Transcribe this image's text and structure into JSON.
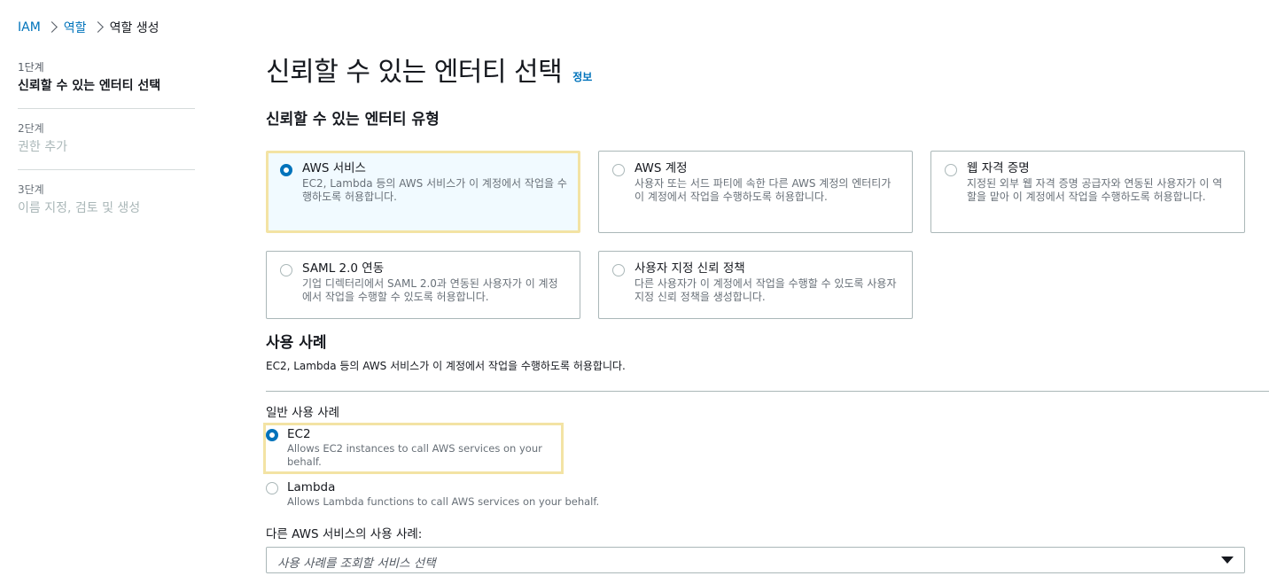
{
  "breadcrumb": {
    "items": [
      "IAM",
      "역할",
      "역할 생성"
    ]
  },
  "steps": [
    {
      "num": "1단계",
      "title": "신뢰할 수 있는 엔터티 선택"
    },
    {
      "num": "2단계",
      "title": "권한 추가"
    },
    {
      "num": "3단계",
      "title": "이름 지정, 검토 및 생성"
    }
  ],
  "page": {
    "title": "신뢰할 수 있는 엔터티 선택",
    "info_label": "정보"
  },
  "entity_type": {
    "title": "신뢰할 수 있는 엔터티 유형",
    "tiles": [
      {
        "title": "AWS 서비스",
        "desc": "EC2, Lambda 등의 AWS 서비스가 이 계정에서 작업을 수행하도록 허용합니다.",
        "selected": true
      },
      {
        "title": "AWS 계정",
        "desc": "사용자 또는 서드 파티에 속한 다른 AWS 계정의 엔터티가 이 계정에서 작업을 수행하도록 허용합니다.",
        "selected": false
      },
      {
        "title": "웹 자격 증명",
        "desc": "지정된 외부 웹 자격 증명 공급자와 연동된 사용자가 이 역할을 맡아 이 계정에서 작업을 수행하도록 허용합니다.",
        "selected": false
      },
      {
        "title": "SAML 2.0 연동",
        "desc": "기업 디렉터리에서 SAML 2.0과 연동된 사용자가 이 계정에서 작업을 수행할 수 있도록 허용합니다.",
        "selected": false
      },
      {
        "title": "사용자 지정 신뢰 정책",
        "desc": "다른 사용자가 이 계정에서 작업을 수행할 수 있도록 사용자 지정 신뢰 정책을 생성합니다.",
        "selected": false
      }
    ]
  },
  "use_case": {
    "title": "사용 사례",
    "desc": "EC2, Lambda 등의 AWS 서비스가 이 계정에서 작업을 수행하도록 허용합니다.",
    "common_label": "일반 사용 사례",
    "options": [
      {
        "title": "EC2",
        "desc": "Allows EC2 instances to call AWS services on your behalf.",
        "selected": true
      },
      {
        "title": "Lambda",
        "desc": "Allows Lambda functions to call AWS services on your behalf.",
        "selected": false
      }
    ],
    "other_label": "다른 AWS 서비스의 사용 사례:",
    "select_placeholder": "사용 사례를 조회할 서비스 선택"
  }
}
